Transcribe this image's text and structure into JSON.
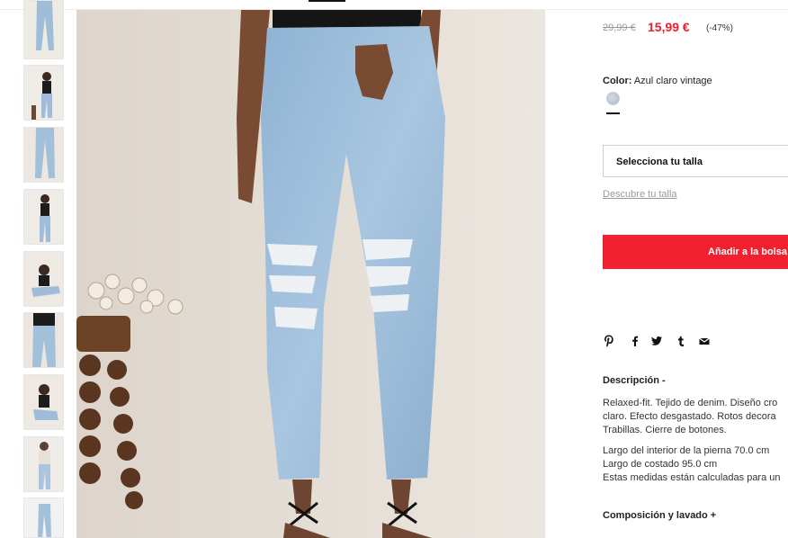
{
  "price": {
    "old": "29,99 €",
    "current": "15,99 €",
    "discount": "(-47%)"
  },
  "color": {
    "label": "Color:",
    "value": "Azul claro vintage",
    "swatch_color": "#b9c6d4"
  },
  "size": {
    "select_label": "Selecciona tu talla",
    "guide_link": "Descubre tu talla"
  },
  "cart": {
    "add_label": "Añadir a la bolsa",
    "button_color": "#f0202f"
  },
  "share_icons": [
    "pinterest-icon",
    "facebook-icon",
    "twitter-icon",
    "tumblr-icon",
    "mail-icon"
  ],
  "description": {
    "title": "Descripción -",
    "text": "Relaxed-fit. Tejido de denim. Diseño cro\nclaro. Efecto desgastado. Rotos decora\nTrabillas. Cierre de botones.",
    "measures": "Largo del interior de la pierna 70.0 cm\nLargo de costado 95.0 cm\nEstas medidas están calculadas para un"
  },
  "composition": {
    "title": "Composición y lavado +"
  },
  "thumbnails": [
    "thumb-1",
    "thumb-2",
    "thumb-3",
    "thumb-4",
    "thumb-5",
    "thumb-6",
    "thumb-7",
    "thumb-8",
    "thumb-9"
  ]
}
